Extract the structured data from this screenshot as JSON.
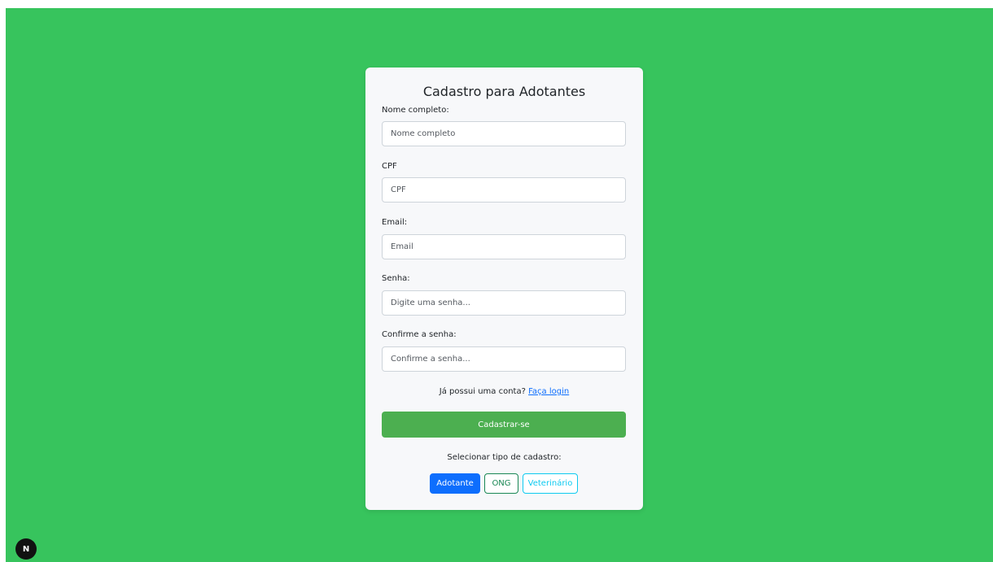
{
  "form": {
    "title": "Cadastro para Adotantes",
    "fields": [
      {
        "label": "Nome completo:",
        "placeholder": "Nome completo",
        "value": ""
      },
      {
        "label": "CPF",
        "placeholder": "CPF",
        "value": ""
      },
      {
        "label": "Email:",
        "placeholder": "Email",
        "value": ""
      },
      {
        "label": "Senha:",
        "placeholder": "Digite uma senha...",
        "value": ""
      },
      {
        "label": "Confirme a senha:",
        "placeholder": "Confirme a senha...",
        "value": ""
      }
    ],
    "login_prompt": "Já possui uma conta?",
    "login_link": "Faça login",
    "submit_label": "Cadastrar-se",
    "type_label": "Selecionar tipo de cadastro:",
    "types": [
      "Adotante",
      "ONG",
      "Veterinário"
    ],
    "selected_type": "Adotante"
  },
  "dev_badge": {
    "letter": "N",
    "icon": "nextjs-logo-icon"
  },
  "colors": {
    "background": "#37c45d",
    "card": "#f7f8fa",
    "submit": "#4caf50",
    "primary": "#0d6efd",
    "success": "#198754",
    "info": "#0dcaf0"
  }
}
